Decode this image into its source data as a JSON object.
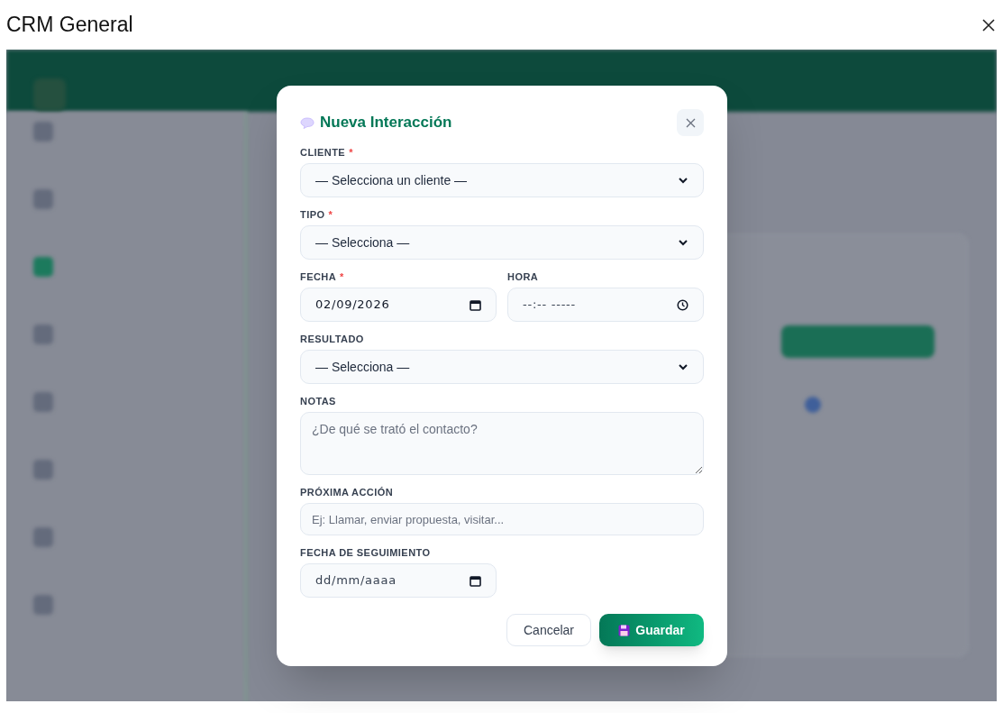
{
  "window": {
    "title": "CRM General"
  },
  "dialog": {
    "title": "Nueva Interacción",
    "rows": [
      [
        {
          "kind": "select",
          "label": "CLIENTE",
          "required_mark": "*",
          "value": "— Selecciona un cliente —"
        }
      ],
      [
        {
          "kind": "select",
          "label": "TIPO",
          "required_mark": "*",
          "value": "— Selecciona —"
        }
      ],
      [
        {
          "kind": "date",
          "label": "FECHA",
          "required_mark": "*",
          "value": "02/09/2026"
        },
        {
          "kind": "time",
          "label": "HORA",
          "placeholder": "--:-- -----"
        }
      ],
      [
        {
          "kind": "select",
          "label": "RESULTADO",
          "value": "— Selecciona —"
        }
      ],
      [
        {
          "kind": "textarea",
          "label": "NOTAS",
          "placeholder": "¿De qué se trató el contacto?"
        }
      ],
      [
        {
          "kind": "text",
          "label": "PRÓXIMA ACCIÓN",
          "placeholder": "Ej: Llamar, enviar propuesta, visitar..."
        }
      ],
      [
        {
          "kind": "date",
          "label": "FECHA DE SEGUIMIENTO",
          "placeholder": "dd/mm/aaaa"
        },
        {
          "kind": "empty"
        }
      ]
    ],
    "buttons": [
      {
        "kind": "secondary",
        "label": "Cancelar"
      },
      {
        "kind": "primary",
        "label": "Guardar"
      }
    ]
  }
}
